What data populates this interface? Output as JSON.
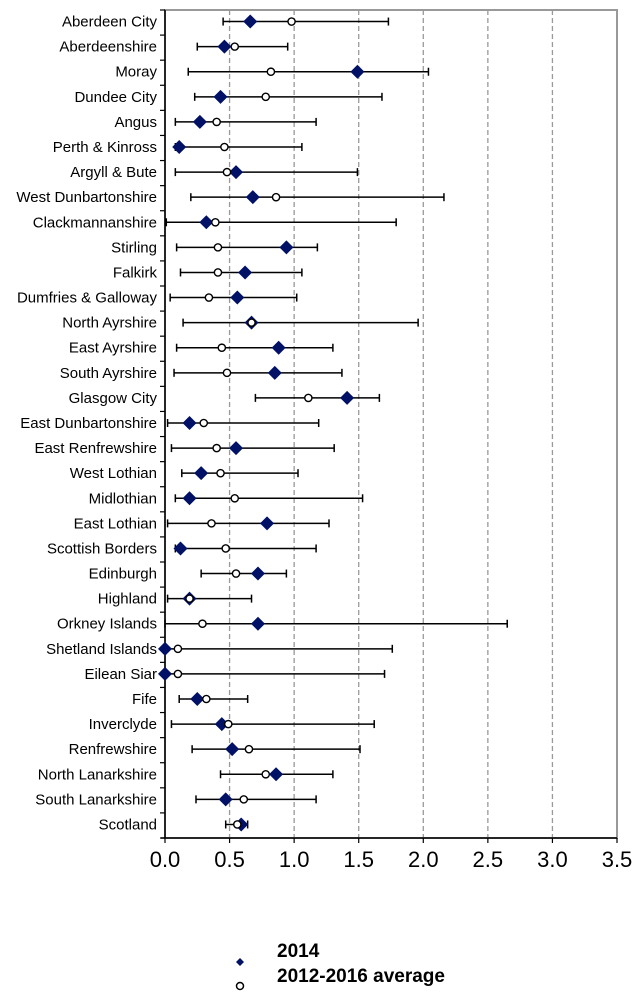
{
  "chart_data": {
    "type": "scatter",
    "subtype": "horizontal-point-with-error-bars",
    "title": "",
    "xlabel": "",
    "ylabel": "",
    "xlim": [
      0.0,
      3.5
    ],
    "x_ticks": [
      0.0,
      0.5,
      1.0,
      1.5,
      2.0,
      2.5,
      3.0,
      3.5
    ],
    "x_tick_labels": [
      "0.0",
      "0.5",
      "1.0",
      "1.5",
      "2.0",
      "2.5",
      "3.0",
      "3.5"
    ],
    "grid": "vertical dashed",
    "legend_position": "bottom-center",
    "colors": {
      "series_2014": "#001166",
      "series_average": "#ffffff",
      "error_bar": "#000000",
      "grid": "#999999"
    },
    "categories": [
      "Aberdeen City",
      "Aberdeenshire",
      "Moray",
      "Dundee City",
      "Angus",
      "Perth & Kinross",
      "Argyll & Bute",
      "West Dunbartonshire",
      "Clackmannanshire",
      "Stirling",
      "Falkirk",
      "Dumfries & Galloway",
      "North Ayrshire",
      "East Ayrshire",
      "South Ayrshire",
      "Glasgow City",
      "East Dunbartonshire",
      "East Renfrewshire",
      "West Lothian",
      "Midlothian",
      "East Lothian",
      "Scottish Borders",
      "Edinburgh",
      "Highland",
      "Orkney Islands",
      "Shetland Islands",
      "Eilean Siar",
      "Fife",
      "Inverclyde",
      "Renfrewshire",
      "North Lanarkshire",
      "South Lanarkshire",
      "Scotland"
    ],
    "series": [
      {
        "name": "2014",
        "marker": "diamond",
        "values": [
          0.66,
          0.46,
          1.49,
          0.43,
          0.27,
          0.11,
          0.55,
          0.68,
          0.32,
          0.94,
          0.62,
          0.56,
          0.67,
          0.88,
          0.85,
          1.41,
          0.19,
          0.55,
          0.28,
          0.19,
          0.79,
          0.12,
          0.72,
          0.19,
          0.72,
          0.0,
          0.0,
          0.25,
          0.44,
          0.52,
          0.86,
          0.47,
          0.59
        ]
      },
      {
        "name": "2012-2016 average",
        "marker": "open-circle",
        "values": [
          0.98,
          0.54,
          0.82,
          0.78,
          0.4,
          0.46,
          0.48,
          0.86,
          0.39,
          0.41,
          0.41,
          0.34,
          0.67,
          0.44,
          0.48,
          1.11,
          0.3,
          0.4,
          0.43,
          0.54,
          0.36,
          0.47,
          0.55,
          0.19,
          0.29,
          0.1,
          0.1,
          0.32,
          0.49,
          0.65,
          0.78,
          0.61,
          0.56
        ]
      }
    ],
    "error_bars": {
      "lower": [
        0.45,
        0.25,
        0.18,
        0.23,
        0.08,
        0.08,
        0.08,
        0.2,
        0.01,
        0.09,
        0.12,
        0.04,
        0.14,
        0.09,
        0.07,
        0.7,
        0.02,
        0.05,
        0.13,
        0.08,
        0.02,
        0.08,
        0.28,
        0.02,
        0.0,
        0.0,
        0.0,
        0.11,
        0.05,
        0.21,
        0.43,
        0.24,
        0.47
      ],
      "upper": [
        1.73,
        0.95,
        2.04,
        1.68,
        1.17,
        1.06,
        1.49,
        2.16,
        1.79,
        1.18,
        1.06,
        1.02,
        1.96,
        1.3,
        1.37,
        1.66,
        1.19,
        1.31,
        1.03,
        1.53,
        1.27,
        1.17,
        0.94,
        0.67,
        2.65,
        1.76,
        1.7,
        0.64,
        1.62,
        1.51,
        1.3,
        1.17,
        0.64
      ]
    },
    "legend": [
      "2014",
      "2012-2016 average"
    ]
  }
}
